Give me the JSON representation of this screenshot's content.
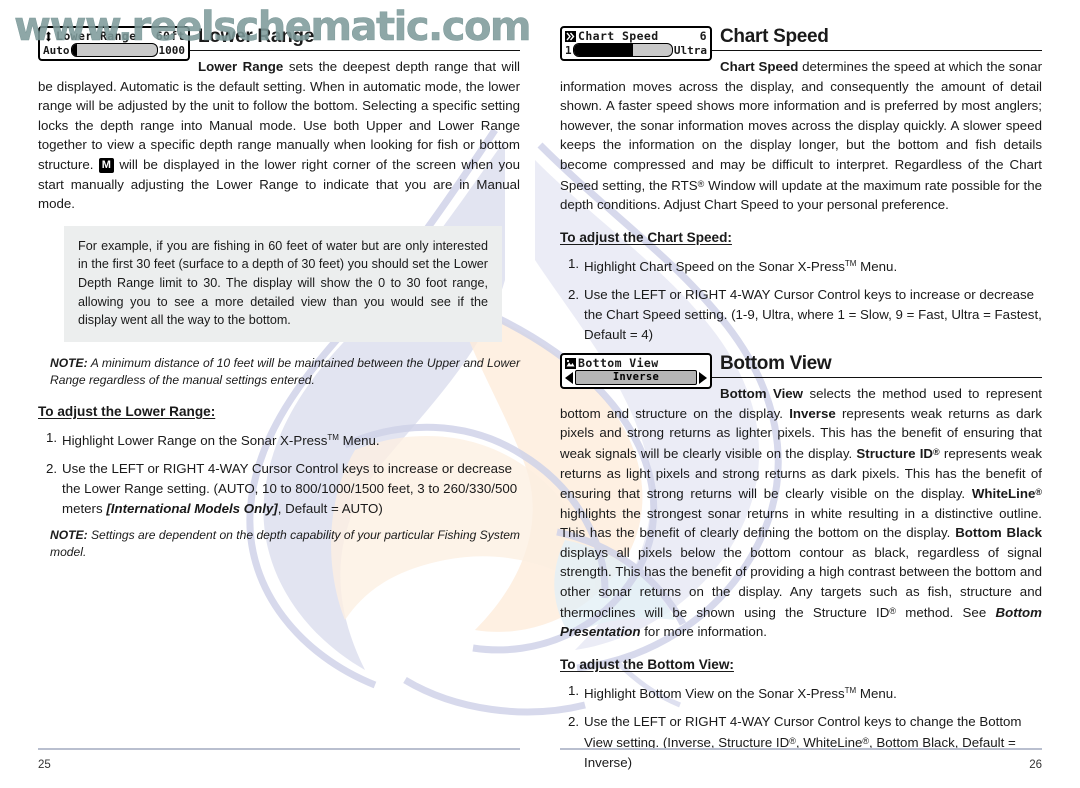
{
  "watermark": {
    "url_text": "www.reelschematic.com",
    "color": "#7f9b9b"
  },
  "left_page": {
    "page_number": "25",
    "widget": {
      "name": "lower-range-menu",
      "icon": "up-down-arrow-icon",
      "title": "Lower Range",
      "value": "60ft",
      "min_label": "Auto",
      "max_label": "1000",
      "fill_percent": 6
    },
    "heading": "Lower Range",
    "intro_paragraph_html": "<b>Lower Range</b> sets the deepest depth range that will be displayed. Automatic is the default setting. When in automatic mode, the lower range will be adjusted by the unit to follow the bottom. Selecting a specific setting locks the depth range into Manual mode. Use both Upper and Lower Range together to view a specific depth range manually when looking for fish or bottom structure. <span class=\"m-chip\">M</span> will be displayed in the lower right corner of the screen when you start manually adjusting the Lower Range to indicate that you are in Manual mode.",
    "example_box": "For example, if you are fishing in 60 feet of water but are only interested in the first 30 feet (surface to a depth of 30 feet) you should set the Lower Depth Range limit to 30.  The display will show the 0 to 30 foot range, allowing you to see a more detailed view than you would see if the display went all the way to the bottom.",
    "note_1_label": "NOTE:",
    "note_1_text": " A minimum distance of 10 feet will be maintained between the Upper and Lower Range regardless of the manual settings entered.",
    "subheading": "To adjust the Lower Range:",
    "steps": [
      {
        "num": "1.",
        "html": "Highlight Lower Range on the Sonar X-Press<sup class=\"tm\">TM</sup> Menu."
      },
      {
        "num": "2.",
        "html": "Use the LEFT or RIGHT 4-WAY Cursor Control keys to increase or decrease the Lower Range setting. (AUTO, 10 to 800/1000/1500 feet, 3 to 260/330/500 meters <i><b>[International Models Only]</b></i>, Default = AUTO)"
      }
    ],
    "note_2_label": "NOTE:",
    "note_2_text": " Settings are dependent on the depth capability of your particular Fishing System model."
  },
  "right_page": {
    "page_number": "26",
    "section_1": {
      "widget": {
        "name": "chart-speed-menu",
        "icon": "speed-lines-icon",
        "title": "Chart Speed",
        "value": "6",
        "min_label": "1",
        "max_label": "Ultra",
        "fill_percent": 60
      },
      "heading": "Chart Speed",
      "paragraph_html": "<b>Chart Speed</b> determines the speed at which the sonar information moves across the display, and consequently the amount of detail shown. A faster speed shows more information and is preferred by most anglers; however, the sonar information moves across the display quickly. A slower speed keeps the information on the display longer, but the bottom and fish details become compressed and may be difficult to interpret. Regardless of the Chart Speed setting, the RTS<sup class=\"reg\">&reg;</sup> Window will update at the maximum rate possible for the depth conditions. Adjust Chart Speed to your personal preference.",
      "subheading": "To adjust the Chart Speed:",
      "steps": [
        {
          "num": "1.",
          "html": "Highlight Chart Speed on the Sonar X-Press<sup class=\"tm\">TM</sup> Menu."
        },
        {
          "num": "2.",
          "html": "Use the LEFT or RIGHT 4-WAY Cursor Control keys to increase or decrease the Chart Speed setting. (1-9, Ultra, where 1 = Slow, 9 = Fast, Ultra = Fastest, Default = 4)"
        }
      ]
    },
    "section_2": {
      "widget": {
        "name": "bottom-view-menu",
        "icon": "mountain-image-icon",
        "title": "Bottom View",
        "selected_value": "Inverse",
        "left_arrow": "left-arrow-icon",
        "right_arrow": "right-arrow-icon"
      },
      "heading": "Bottom View",
      "paragraph_html": "<b>Bottom View</b> selects the method used to represent bottom and structure on the display. <b>Inverse</b> represents weak returns as dark pixels and strong returns as lighter pixels. This has the benefit of ensuring that weak signals will be clearly visible on the display. <b>Structure ID<sup class=\"reg\">&reg;</sup></b> represents weak returns as light pixels and strong returns as dark pixels.  This has the benefit of ensuring that strong returns will be clearly visible on the display.  <b>WhiteLine<sup class=\"reg\">&reg;</sup></b> highlights the strongest sonar returns in white resulting in a distinctive outline.  This has the benefit of clearly defining the bottom on the display. <b>Bottom Black</b> displays all pixels below the bottom contour as black, regardless of signal strength. This has the benefit of providing a high contrast between the bottom and other sonar returns on the display. Any targets such as fish, structure and thermoclines will be shown using the Structure ID<sup class=\"reg\">&reg;</sup> method. See <b><i>Bottom Presentation</i></b> for more information.",
      "subheading": "To adjust the Bottom View:",
      "steps": [
        {
          "num": "1.",
          "html": "Highlight Bottom View on the Sonar X-Press<sup class=\"tm\">TM</sup> Menu."
        },
        {
          "num": "2.",
          "html": "Use the LEFT or RIGHT 4-WAY Cursor Control keys to change the Bottom View setting. (Inverse, Structure ID<sup class=\"reg\">&reg;</sup>, WhiteLine<sup class=\"reg\">&reg;</sup>, Bottom Black, Default = Inverse)"
        }
      ]
    }
  }
}
